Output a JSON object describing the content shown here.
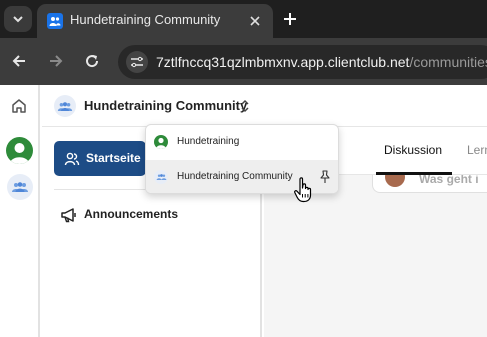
{
  "browser": {
    "tab": {
      "title": "Hundetraining Community"
    },
    "address": {
      "host": "7ztlfnccq31qzlmbmxnv.app.clientclub.net",
      "path": "/communities"
    }
  },
  "rail": {
    "icons": [
      "home-icon",
      "community-avatar-green",
      "community-avatar-blue"
    ]
  },
  "header": {
    "community_name": "Hundetraining Community"
  },
  "sidebar": {
    "nav": [
      {
        "label": "Startseite",
        "icon": "users-icon",
        "active": true
      }
    ],
    "channels": [
      {
        "label": "Announcements",
        "icon": "megaphone-icon"
      }
    ]
  },
  "content": {
    "tabs": [
      {
        "label": "Diskussion",
        "active": true
      },
      {
        "label": "Lern"
      }
    ],
    "post_prompt": "Was geht i"
  },
  "dropdown": {
    "items": [
      {
        "label": "Hundetraining",
        "icon": "green-avatar"
      },
      {
        "label": "Hundetraining Community",
        "icon": "blue-avatar",
        "hovered": true,
        "pin": "pin-icon"
      }
    ]
  },
  "colors": {
    "primary": "#1d4c86",
    "green": "#2e8b3a",
    "chrome_dark": "#1f1f1f"
  }
}
